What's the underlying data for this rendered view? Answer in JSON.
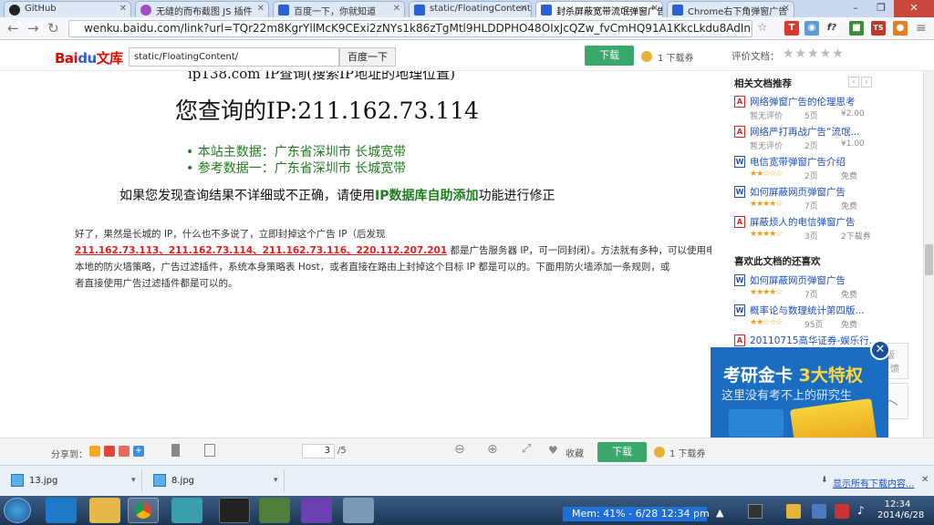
{
  "browser": {
    "tabs": [
      {
        "label": "GitHub",
        "active": false
      },
      {
        "label": "无缝的而布截图 JS 插件",
        "active": false
      },
      {
        "label": "百度一下，你就知道",
        "active": false
      },
      {
        "label": "static/FloatingContent/",
        "active": false
      },
      {
        "label": "封杀屏蔽宽带流氓弹窗广告",
        "active": true
      },
      {
        "label": "Chrome右下角弹窗广告",
        "active": false
      }
    ],
    "url": "wenku.baidu.com/link?url=TQr22m8KgrYllMcK9CExi2zNYs1k86zTgMtl9HLDDPHO48OIxJcQZw_fvCmHQ91A1KkcLkdu8AdIno5iJL"
  },
  "site": {
    "logo_text": "Bai",
    "logo_mid": "du",
    "logo_suffix": "文库",
    "search_value": "static/FloatingContent/",
    "search_button": "百度一下",
    "download_label": "下载",
    "coupon_label": "1 下载券",
    "rating_label": "评价文档："
  },
  "document": {
    "top_title": "ip138.com IP查询(搜索IP地址的地理位置)",
    "big_title": "您查询的IP:211.162.73.114",
    "bullet1": "• 本站主数据：广东省深圳市 长城宽带",
    "bullet2": "• 参考数据一：广东省深圳市 长城宽带",
    "hint_prefix": "如果您发现查询结果不详细或不正确，请使用",
    "hint_bold": "IP数据库自助添加",
    "hint_suffix": "功能进行修正",
    "para_line1": "好了，果然是长城的 IP，什么也不多说了，立即封掉这个广告 IP（后发现",
    "para_red": "211.162.73.113、211.162.73.114、211.162.73.116、220.112.207.201",
    "para_line2_rest": "都是广告服务器 IP，可一同封闭）。方法就有多种，可以使用电脑",
    "para_line3": "本地的防火墙策略，广告过滤插件，系统本身策略表 Host，或者直接在路由上封掉这个目标 IP 都是可以的。下面用防火墙添加一条规则，或",
    "para_line4": "者直接使用广告过滤插件都是可以的。"
  },
  "sidebar": {
    "related_title": "相关文档推荐",
    "liked_title": "喜欢此文档的还喜欢",
    "related": [
      {
        "type": "pdf",
        "title": "网络弹窗广告的伦理思考",
        "rating": "暂无评价",
        "pages": "5页",
        "price": "¥2.00"
      },
      {
        "type": "pdf",
        "title": "网络严打再战广告“流氓...",
        "rating": "暂无评价",
        "pages": "2页",
        "price": "¥1.00"
      },
      {
        "type": "w",
        "title": "电信宽带弹窗广告介绍",
        "stars": 2,
        "pages": "2页",
        "price": "免费"
      },
      {
        "type": "w",
        "title": "如何屏蔽网页弹窗广告",
        "stars": 4,
        "pages": "7页",
        "price": "免费"
      },
      {
        "type": "pdf",
        "title": "屏蔽烦人的电信弹窗广告",
        "stars": 4,
        "pages": "3页",
        "price": "2下载券"
      }
    ],
    "liked": [
      {
        "type": "w",
        "title": "如何屏蔽网页弹窗广告",
        "stars": 4,
        "pages": "7页",
        "price": "免费"
      },
      {
        "type": "w",
        "title": "概率论与数理统计第四版...",
        "stars": 2,
        "pages": "95页",
        "price": "免费"
      },
      {
        "type": "pdf",
        "title": "20110715高华证券-娱乐行...",
        "stars": 0,
        "pages": "",
        "price": ""
      }
    ],
    "float_btn": "版\n反馈"
  },
  "ad": {
    "line1_a": "考研金卡 ",
    "line1_b": "3大特权",
    "line2": "这里没有考不上的研究生"
  },
  "footer": {
    "share_label": "分享到：",
    "page_current": "3",
    "page_total": "/5",
    "collect_label": "收藏",
    "download_label": "下载",
    "coupon_label": "1 下载券"
  },
  "downloads": {
    "items": [
      "13.jpg",
      "8.jpg"
    ],
    "show_all": "显示所有下载内容..."
  },
  "taskbar": {
    "mem_text": "Mem: 41% - 6/28   12:34 pm",
    "time": "12:34",
    "date": "2014/6/28"
  }
}
